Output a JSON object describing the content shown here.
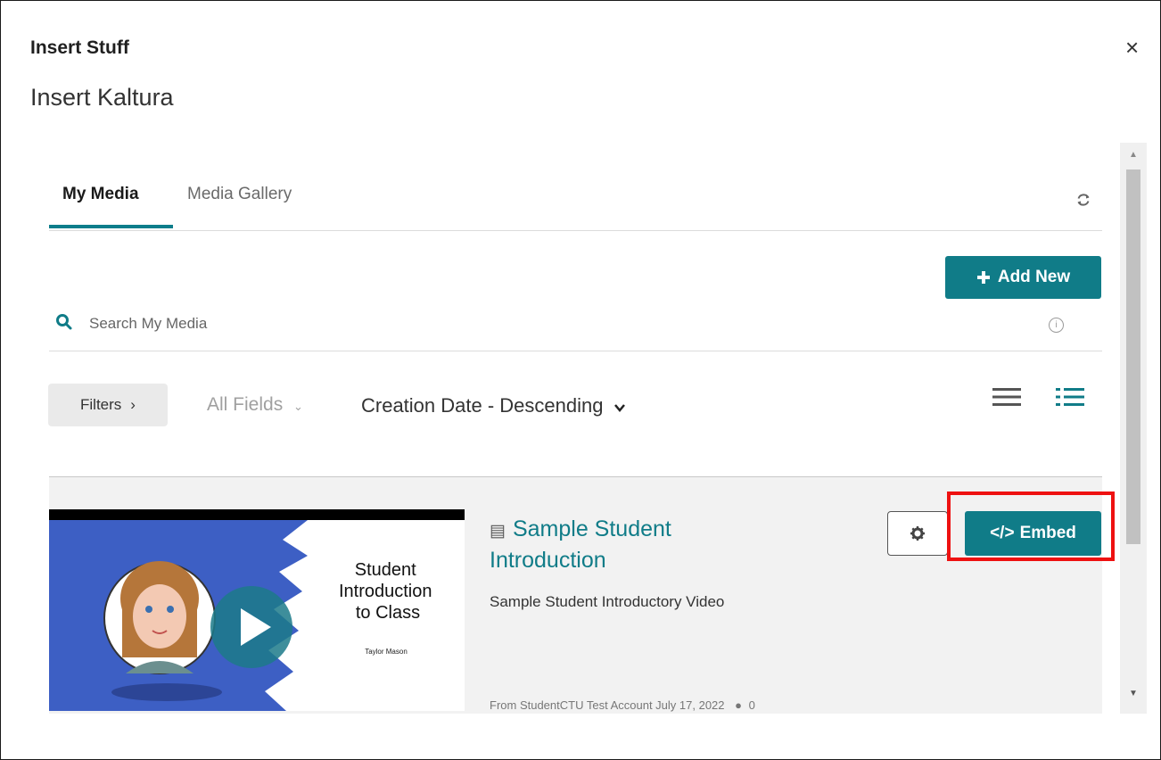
{
  "dialog": {
    "title": "Insert Stuff",
    "subtitle": "Insert Kaltura",
    "close_glyph": "×"
  },
  "tabs": [
    {
      "label": "My Media",
      "active": true
    },
    {
      "label": "Media Gallery",
      "active": false
    }
  ],
  "toolbar": {
    "add_new_label": "Add New",
    "add_icon": "plus-icon",
    "refresh_icon": "refresh-icon"
  },
  "search": {
    "placeholder": "Search My Media",
    "value": ""
  },
  "filters": {
    "filters_label": "Filters",
    "fields_label": "All Fields",
    "sort_label": "Creation Date - Descending"
  },
  "media_items": [
    {
      "title": "Sample Student Introduction",
      "description": "Sample Student Introductory Video",
      "meta": "From StudentCTU Test Account July 17, 2022",
      "comments": "0",
      "embed_label": "Embed",
      "thumbnail": {
        "heading_lines": [
          "Student",
          "Introduction",
          "to Class"
        ],
        "author": "Taylor Mason"
      }
    }
  ],
  "colors": {
    "accent": "#107c88",
    "highlight": "#ee1111"
  }
}
